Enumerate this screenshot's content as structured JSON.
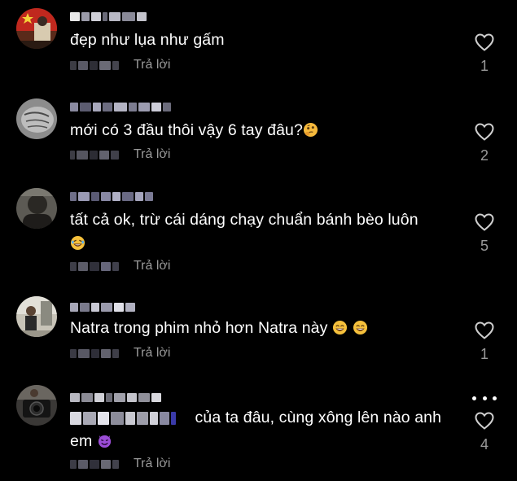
{
  "reply_label": "Trả lời",
  "colors": {
    "background": "#000000",
    "text": "#ffffff",
    "secondary_text": "#9a9a9a",
    "heart_outline": "#cfcfcf"
  },
  "comments": [
    {
      "text": "đẹp như lụa như gấm",
      "likes": "1",
      "avatar": "avatar-red-flag-photo"
    },
    {
      "text": "mới có 3 đầu thôi vậy 6 tay đâu?",
      "emoji": "thinking-face",
      "likes": "2",
      "avatar": "avatar-gray-texture-photo"
    },
    {
      "text_line1": "tất cả ok, trừ cái dáng chạy chuẩn bánh bèo luôn",
      "emoji": "laughing-face",
      "likes": "5",
      "avatar": "avatar-dark-portrait-photo"
    },
    {
      "text": "Natra trong phim nhỏ hơn Natra này",
      "emoji": "grinning-face",
      "likes": "1",
      "avatar": "avatar-outdoor-photo"
    },
    {
      "text_line1": "của ta đâu, cùng xông lên nào anh",
      "text_line2": "em",
      "emoji": "smiling-devil",
      "likes": "4",
      "avatar": "avatar-camera-photo"
    }
  ]
}
